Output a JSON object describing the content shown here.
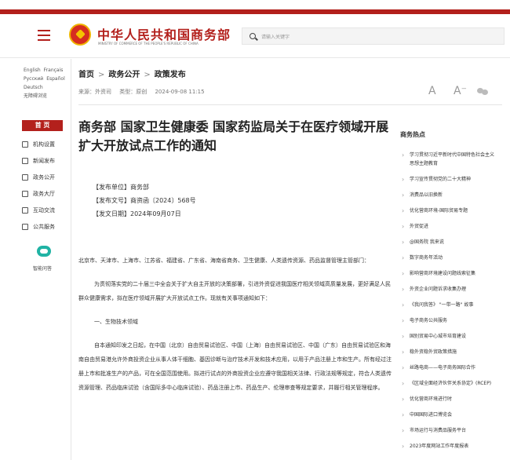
{
  "header": {
    "org_name": "中华人民共和国商务部",
    "org_en": "MINISTRY OF COMMERCE OF THE PEOPLE'S REPUBLIC OF CHINA",
    "search_placeholder": "请输入关键字"
  },
  "languages": [
    "English",
    "Français",
    "Русский",
    "Español",
    "Deutsch",
    "无障碍浏览"
  ],
  "breadcrumb": [
    "首页",
    "政务公开",
    "政策发布"
  ],
  "meta": {
    "source": "来源：外资司",
    "type": "类型：原创",
    "date": "2024-09-08 11:15"
  },
  "font_controls": {
    "a_large": "A",
    "a_small": "A⁻"
  },
  "left_nav": {
    "home": "首 页",
    "items": [
      "机构设置",
      "新闻发布",
      "政务公开",
      "政务大厅",
      "互动交流",
      "公共服务"
    ],
    "smart_qa": "智能问答"
  },
  "article": {
    "title": "商务部 国家卫生健康委 国家药监局关于在医疗领域开展扩大开放试点工作的通知",
    "issuer": "【发布单位】商务部",
    "doc_no": "【发布文号】商资函〔2024〕568号",
    "issue_date": "【发文日期】2024年09月07日",
    "p1": "北京市、天津市、上海市、江苏省、福建省、广东省、海南省商务、卫生健康、人类遗传资源、药品监督管理主管部门：",
    "p2": "为贯彻落实党的二十届三中全会关于扩大自主开放的决策部署，引进外资促进我国医疗相关领域高质量发展，更好满足人民群众健康需求，拟在医疗领域开展扩大开放试点工作。现就有关事项通知如下：",
    "section1": "一、生物技术领域",
    "p3": "自本通知印发之日起，在中国（北京）自由贸易试验区、中国（上海）自由贸易试验区、中国（广东）自由贸易试验区和海南自由贸易港允许外商投资企业从事人体干细胞、基因诊断与治疗技术开发和技术应用，以用于产品注册上市和生产。所有经过注册上市和批准生产的产品，可在全国范围使用。拟进行试点的外商投资企业应遵守我国相关法律、行政法规等规定，符合人类遗传资源管理、药品临床试验（含国际多中心临床试验）、药品注册上市、药品生产、伦理审查等规定要求，并履行相关管理程序。"
  },
  "hot": {
    "title": "商务热点",
    "items": [
      "学习贯彻习近平新时代中国特色社会主义思想主题教育",
      "学习宣传贯彻党的二十大精神",
      "消费品以旧换新",
      "优化营商环境-国际贸易专题",
      "外贸促进",
      "@国务院 我来说",
      "数字商务年活动",
      "影响营商环境建设问题线索征集",
      "外资企业问题诉求收集办理",
      "《我问我答》 \"一带一路\" 故事",
      "电子商务公共服务",
      "国别贸易中心城市培育建设",
      "稳外资稳外贸政策措施",
      "丝路电商——电子商务国际合作",
      "《区域全面经济伙伴关系协定》(RCEP)",
      "优化营商环境进行时",
      "中国国际进口博览会",
      "市场运行与消费品服务平台",
      "2023年度网站工作年度报表"
    ]
  }
}
